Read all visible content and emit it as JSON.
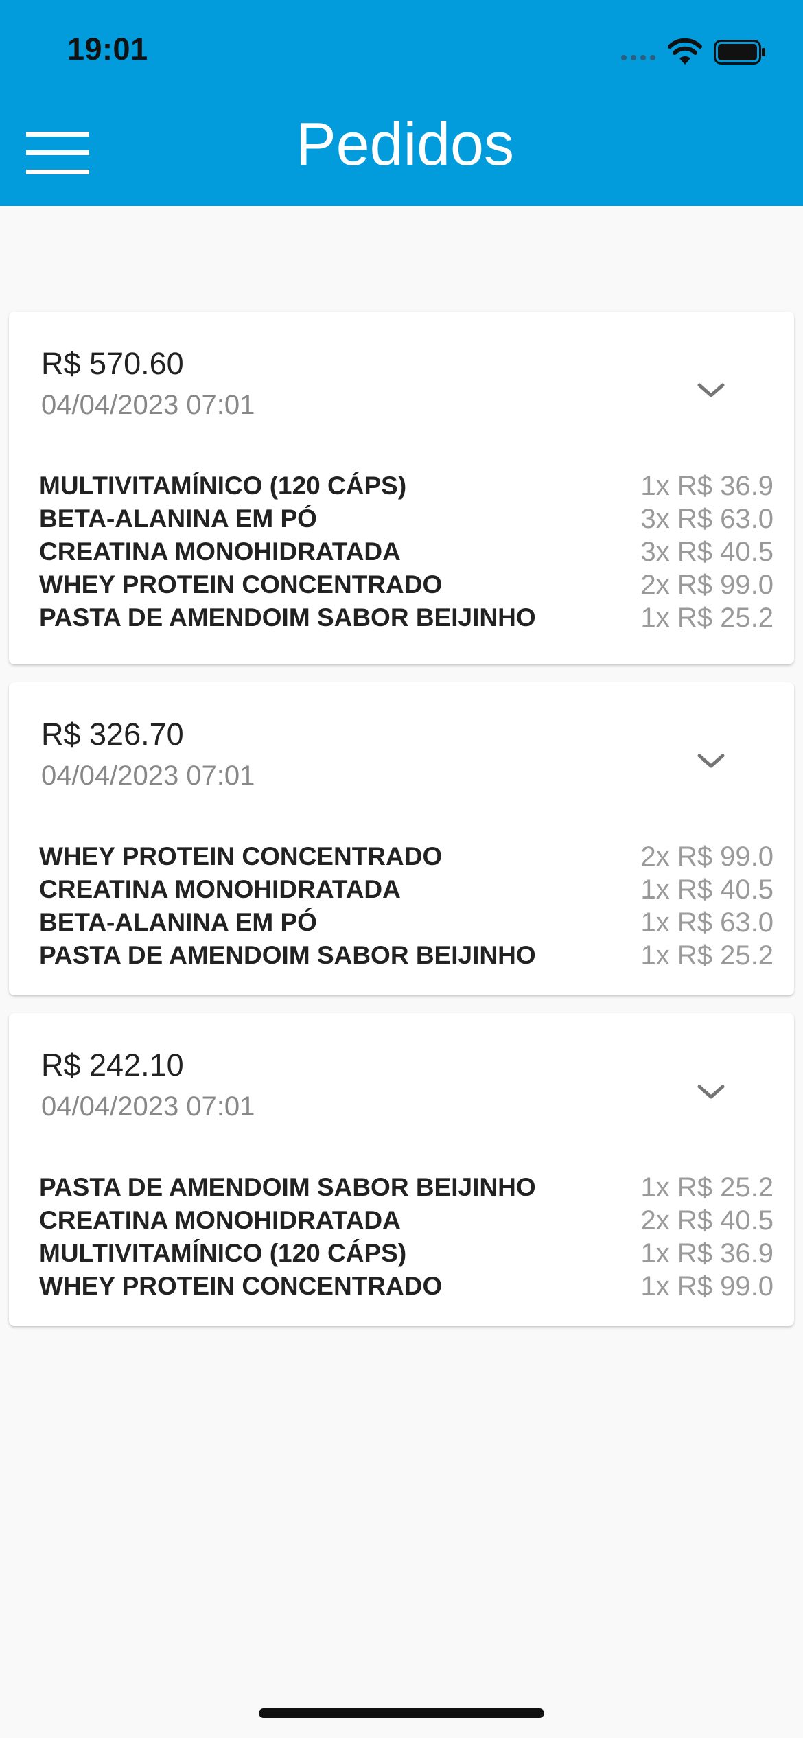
{
  "status_bar": {
    "time": "19:01"
  },
  "header": {
    "title": "Pedidos",
    "background_color": "#029CDC"
  },
  "orders": [
    {
      "total": "R$ 570.60",
      "date": "04/04/2023 07:01",
      "items": [
        {
          "name": "MULTIVITAMÍNICO (120 CÁPS)",
          "price": "1x R$ 36.9"
        },
        {
          "name": "BETA-ALANINA EM PÓ",
          "price": "3x R$ 63.0"
        },
        {
          "name": "CREATINA MONOHIDRATADA",
          "price": "3x R$ 40.5"
        },
        {
          "name": "WHEY PROTEIN CONCENTRADO",
          "price": "2x R$ 99.0"
        },
        {
          "name": "PASTA DE AMENDOIM SABOR BEIJINHO",
          "price": "1x R$ 25.2"
        }
      ]
    },
    {
      "total": "R$ 326.70",
      "date": "04/04/2023 07:01",
      "items": [
        {
          "name": "WHEY PROTEIN CONCENTRADO",
          "price": "2x R$ 99.0"
        },
        {
          "name": "CREATINA MONOHIDRATADA",
          "price": "1x R$ 40.5"
        },
        {
          "name": "BETA-ALANINA EM PÓ",
          "price": "1x R$ 63.0"
        },
        {
          "name": "PASTA DE AMENDOIM SABOR BEIJINHO",
          "price": "1x R$ 25.2"
        }
      ]
    },
    {
      "total": "R$ 242.10",
      "date": "04/04/2023 07:01",
      "items": [
        {
          "name": "PASTA DE AMENDOIM SABOR BEIJINHO",
          "price": "1x R$ 25.2"
        },
        {
          "name": "CREATINA MONOHIDRATADA",
          "price": "2x R$ 40.5"
        },
        {
          "name": "MULTIVITAMÍNICO (120 CÁPS)",
          "price": "1x R$ 36.9"
        },
        {
          "name": "WHEY PROTEIN CONCENTRADO",
          "price": "1x R$ 99.0"
        }
      ]
    }
  ]
}
